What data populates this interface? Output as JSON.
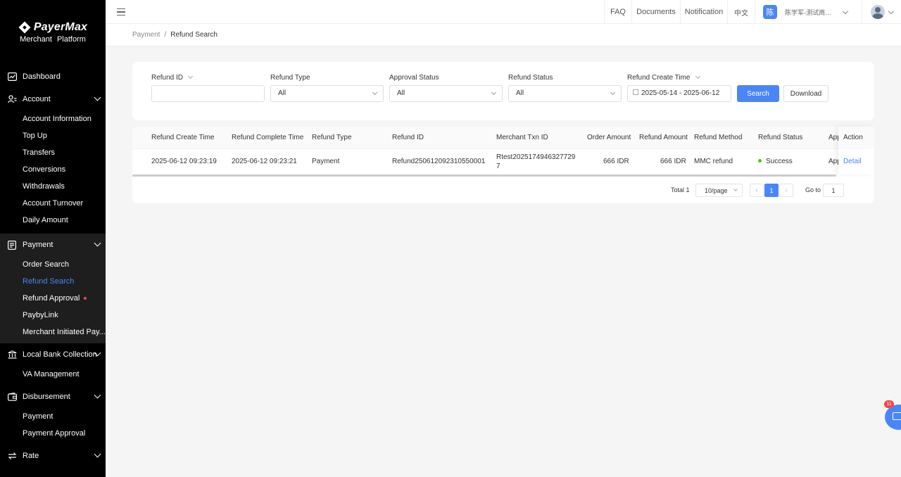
{
  "brand": {
    "name": "PayerMax",
    "subtitle": "Merchant  Platform"
  },
  "sidebar": {
    "dashboard": "Dashboard",
    "account": {
      "label": "Account",
      "items": [
        "Account Information",
        "Top Up",
        "Transfers",
        "Conversions",
        "Withdrawals",
        "Account Turnover",
        "Daily Amount"
      ]
    },
    "payment": {
      "label": "Payment",
      "items": [
        "Order Search",
        "Refund Search",
        "Refund Approval",
        "PaybyLink",
        "Merchant Initiated Pay..."
      ],
      "active": "Refund Search"
    },
    "local_bank": {
      "label": "Local Bank Collection",
      "items": [
        "VA Management"
      ]
    },
    "disbursement": {
      "label": "Disbursement",
      "items": [
        "Payment",
        "Payment Approval"
      ]
    },
    "rate": {
      "label": "Rate"
    }
  },
  "header": {
    "faq": "FAQ",
    "documents": "Documents",
    "notification": "Notification",
    "language": "中文",
    "user_initial": "陈",
    "user_name": "陈学军-测试商..."
  },
  "breadcrumb": {
    "parent": "Payment",
    "separator": "/",
    "current": "Refund Search"
  },
  "filters": {
    "refund_id": {
      "label": "Refund ID",
      "value": ""
    },
    "refund_type": {
      "label": "Refund Type",
      "value": "All"
    },
    "approval_status": {
      "label": "Approval Status",
      "value": "All"
    },
    "refund_status": {
      "label": "Refund Status",
      "value": "All"
    },
    "refund_create_time": {
      "label": "Refund Create Time",
      "value": "2025-05-14 - 2025-06-12"
    },
    "search_label": "Search",
    "download_label": "Download"
  },
  "table": {
    "columns": [
      "Refund Create Time",
      "Refund Complete Time",
      "Refund Type",
      "Refund ID",
      "Merchant Txn ID",
      "Order Amount",
      "Refund Amount",
      "Refund Method",
      "Refund Status",
      "App",
      "Action"
    ],
    "rows": [
      {
        "create_time": "2025-06-12 09:23:19",
        "complete_time": "2025-06-12 09:23:21",
        "type": "Payment",
        "refund_id": "Refund250612092310550001",
        "txn_id_line1": "Rtest2025174946327729",
        "txn_id_line2": "7",
        "order_amount": "666 IDR",
        "refund_amount": "666 IDR",
        "method": "MMC refund",
        "status": "Success",
        "approval": "App",
        "action": "Detail"
      }
    ]
  },
  "pagination": {
    "total": "Total 1",
    "page_size": "10/page",
    "current_page": "1",
    "goto_label": "Go to",
    "goto_value": "1"
  },
  "chat": {
    "badge": "11"
  },
  "colors": {
    "accent": "#4a86f7",
    "sidebar_bg": "#000000",
    "success": "#52c41a",
    "danger": "#f04848"
  }
}
